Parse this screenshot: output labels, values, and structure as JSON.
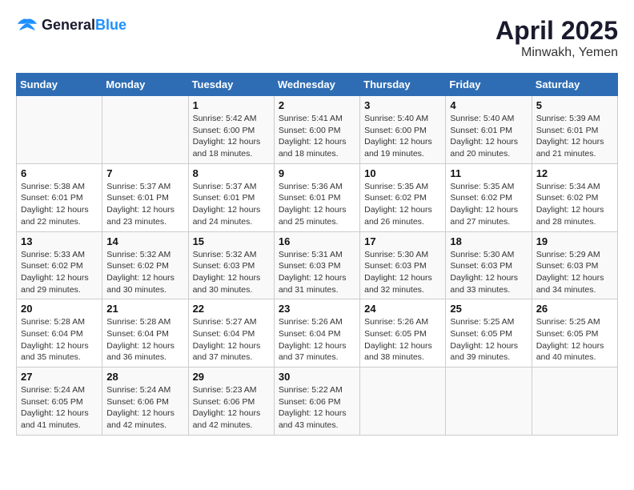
{
  "header": {
    "logo_general": "General",
    "logo_blue": "Blue",
    "title": "April 2025",
    "subtitle": "Minwakh, Yemen"
  },
  "weekdays": [
    "Sunday",
    "Monday",
    "Tuesday",
    "Wednesday",
    "Thursday",
    "Friday",
    "Saturday"
  ],
  "weeks": [
    [
      {
        "day": "",
        "info": ""
      },
      {
        "day": "",
        "info": ""
      },
      {
        "day": "1",
        "info": "Sunrise: 5:42 AM\nSunset: 6:00 PM\nDaylight: 12 hours\nand 18 minutes."
      },
      {
        "day": "2",
        "info": "Sunrise: 5:41 AM\nSunset: 6:00 PM\nDaylight: 12 hours\nand 18 minutes."
      },
      {
        "day": "3",
        "info": "Sunrise: 5:40 AM\nSunset: 6:00 PM\nDaylight: 12 hours\nand 19 minutes."
      },
      {
        "day": "4",
        "info": "Sunrise: 5:40 AM\nSunset: 6:01 PM\nDaylight: 12 hours\nand 20 minutes."
      },
      {
        "day": "5",
        "info": "Sunrise: 5:39 AM\nSunset: 6:01 PM\nDaylight: 12 hours\nand 21 minutes."
      }
    ],
    [
      {
        "day": "6",
        "info": "Sunrise: 5:38 AM\nSunset: 6:01 PM\nDaylight: 12 hours\nand 22 minutes."
      },
      {
        "day": "7",
        "info": "Sunrise: 5:37 AM\nSunset: 6:01 PM\nDaylight: 12 hours\nand 23 minutes."
      },
      {
        "day": "8",
        "info": "Sunrise: 5:37 AM\nSunset: 6:01 PM\nDaylight: 12 hours\nand 24 minutes."
      },
      {
        "day": "9",
        "info": "Sunrise: 5:36 AM\nSunset: 6:01 PM\nDaylight: 12 hours\nand 25 minutes."
      },
      {
        "day": "10",
        "info": "Sunrise: 5:35 AM\nSunset: 6:02 PM\nDaylight: 12 hours\nand 26 minutes."
      },
      {
        "day": "11",
        "info": "Sunrise: 5:35 AM\nSunset: 6:02 PM\nDaylight: 12 hours\nand 27 minutes."
      },
      {
        "day": "12",
        "info": "Sunrise: 5:34 AM\nSunset: 6:02 PM\nDaylight: 12 hours\nand 28 minutes."
      }
    ],
    [
      {
        "day": "13",
        "info": "Sunrise: 5:33 AM\nSunset: 6:02 PM\nDaylight: 12 hours\nand 29 minutes."
      },
      {
        "day": "14",
        "info": "Sunrise: 5:32 AM\nSunset: 6:02 PM\nDaylight: 12 hours\nand 30 minutes."
      },
      {
        "day": "15",
        "info": "Sunrise: 5:32 AM\nSunset: 6:03 PM\nDaylight: 12 hours\nand 30 minutes."
      },
      {
        "day": "16",
        "info": "Sunrise: 5:31 AM\nSunset: 6:03 PM\nDaylight: 12 hours\nand 31 minutes."
      },
      {
        "day": "17",
        "info": "Sunrise: 5:30 AM\nSunset: 6:03 PM\nDaylight: 12 hours\nand 32 minutes."
      },
      {
        "day": "18",
        "info": "Sunrise: 5:30 AM\nSunset: 6:03 PM\nDaylight: 12 hours\nand 33 minutes."
      },
      {
        "day": "19",
        "info": "Sunrise: 5:29 AM\nSunset: 6:03 PM\nDaylight: 12 hours\nand 34 minutes."
      }
    ],
    [
      {
        "day": "20",
        "info": "Sunrise: 5:28 AM\nSunset: 6:04 PM\nDaylight: 12 hours\nand 35 minutes."
      },
      {
        "day": "21",
        "info": "Sunrise: 5:28 AM\nSunset: 6:04 PM\nDaylight: 12 hours\nand 36 minutes."
      },
      {
        "day": "22",
        "info": "Sunrise: 5:27 AM\nSunset: 6:04 PM\nDaylight: 12 hours\nand 37 minutes."
      },
      {
        "day": "23",
        "info": "Sunrise: 5:26 AM\nSunset: 6:04 PM\nDaylight: 12 hours\nand 37 minutes."
      },
      {
        "day": "24",
        "info": "Sunrise: 5:26 AM\nSunset: 6:05 PM\nDaylight: 12 hours\nand 38 minutes."
      },
      {
        "day": "25",
        "info": "Sunrise: 5:25 AM\nSunset: 6:05 PM\nDaylight: 12 hours\nand 39 minutes."
      },
      {
        "day": "26",
        "info": "Sunrise: 5:25 AM\nSunset: 6:05 PM\nDaylight: 12 hours\nand 40 minutes."
      }
    ],
    [
      {
        "day": "27",
        "info": "Sunrise: 5:24 AM\nSunset: 6:05 PM\nDaylight: 12 hours\nand 41 minutes."
      },
      {
        "day": "28",
        "info": "Sunrise: 5:24 AM\nSunset: 6:06 PM\nDaylight: 12 hours\nand 42 minutes."
      },
      {
        "day": "29",
        "info": "Sunrise: 5:23 AM\nSunset: 6:06 PM\nDaylight: 12 hours\nand 42 minutes."
      },
      {
        "day": "30",
        "info": "Sunrise: 5:22 AM\nSunset: 6:06 PM\nDaylight: 12 hours\nand 43 minutes."
      },
      {
        "day": "",
        "info": ""
      },
      {
        "day": "",
        "info": ""
      },
      {
        "day": "",
        "info": ""
      }
    ]
  ]
}
